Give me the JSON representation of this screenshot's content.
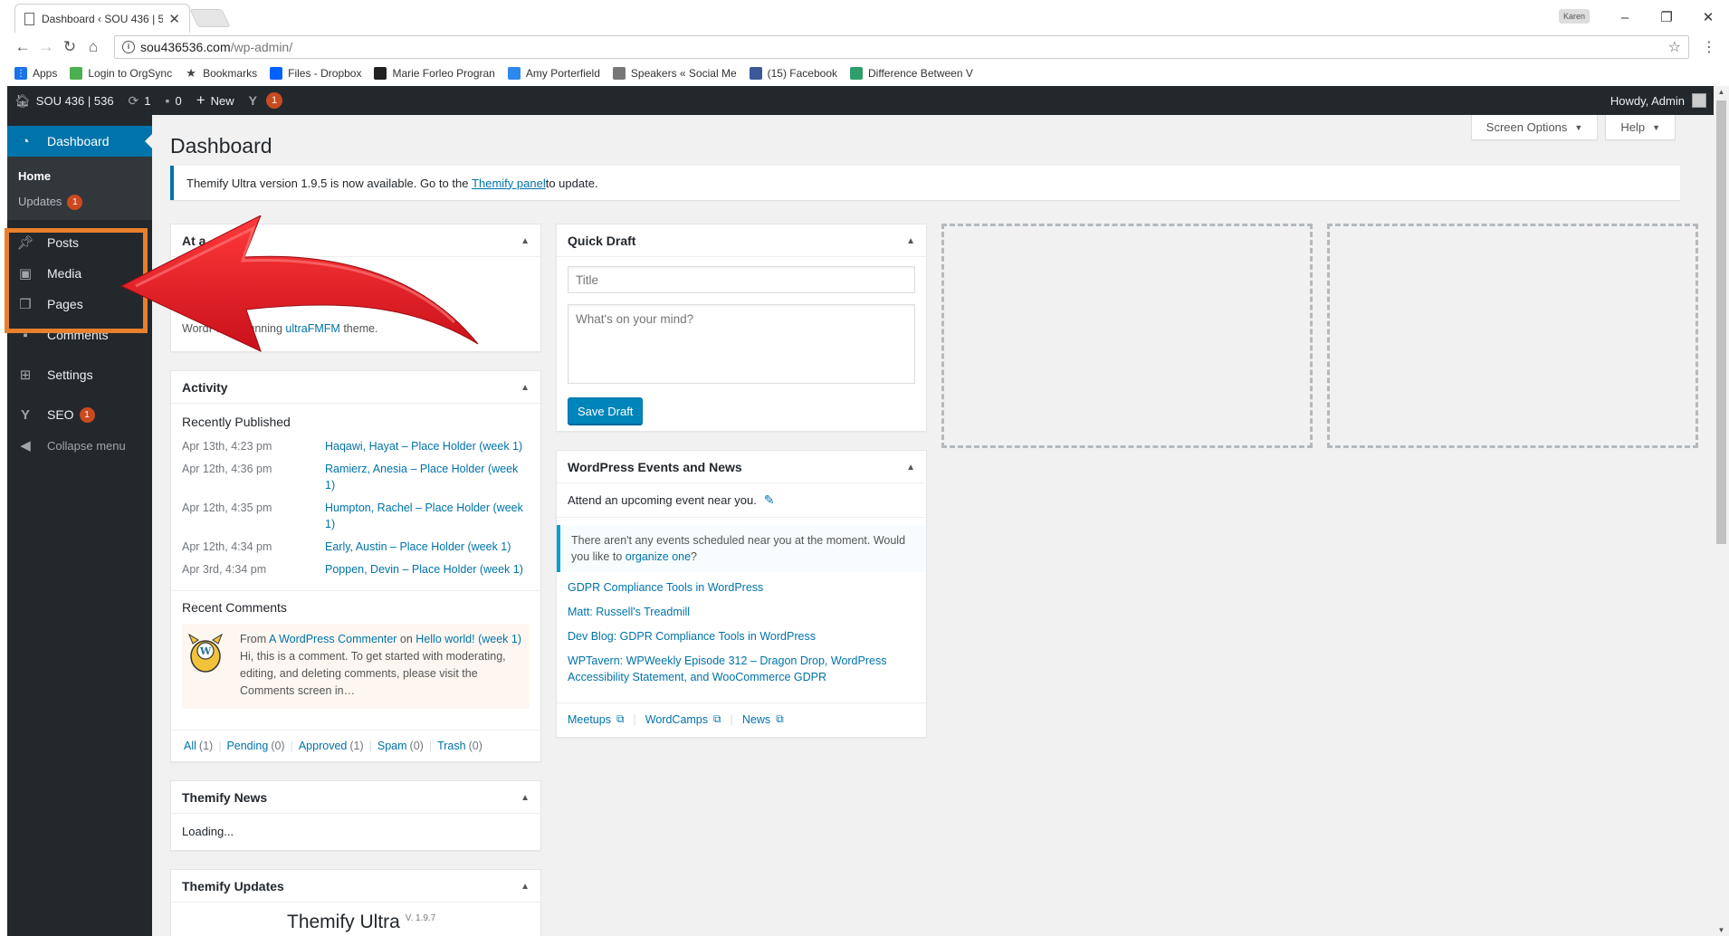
{
  "browser": {
    "tab_title": "Dashboard ‹ SOU 436 | 5",
    "profile_label": "Karen",
    "url_host": "sou436536.com",
    "url_path": "/wp-admin/",
    "bookmarks": [
      {
        "label": "Apps",
        "icon": "apps-grid-icon",
        "color": "#1a73e8"
      },
      {
        "label": "Login to OrgSync",
        "icon": "orgsync-icon",
        "color": "#4caf50"
      },
      {
        "label": "Bookmarks",
        "icon": "star-icon",
        "color": "#444444"
      },
      {
        "label": "Files - Dropbox",
        "icon": "dropbox-icon",
        "color": "#0061ff"
      },
      {
        "label": "Marie Forleo Progran",
        "icon": "mf-icon",
        "color": "#222222"
      },
      {
        "label": "Amy Porterfield",
        "icon": "amy-icon",
        "color": "#2d89ef"
      },
      {
        "label": "Speakers « Social Me",
        "icon": "doc-icon",
        "color": "#777777"
      },
      {
        "label": "(15) Facebook",
        "icon": "facebook-icon",
        "color": "#3b5998"
      },
      {
        "label": "Difference Between V",
        "icon": "c-icon",
        "color": "#2e9e6b"
      }
    ]
  },
  "adminbar": {
    "site_name": "SOU 436 | 536",
    "updates_count": "1",
    "comments_count": "0",
    "new_label": "New",
    "yoast_count": "1",
    "howdy": "Howdy, Admin"
  },
  "sidebar": {
    "dashboard": "Dashboard",
    "home": "Home",
    "updates": "Updates",
    "updates_count": "1",
    "posts": "Posts",
    "media": "Media",
    "pages": "Pages",
    "comments": "Comments",
    "settings": "Settings",
    "seo": "SEO",
    "seo_count": "1",
    "collapse": "Collapse menu"
  },
  "header": {
    "screen_options": "Screen Options",
    "help": "Help",
    "title": "Dashboard"
  },
  "notice": {
    "before": "Themify Ultra version 1.9.5 is now available. Go to the ",
    "link": "Themify panel",
    "after": " to update."
  },
  "at_a_glance": {
    "title": "At a",
    "theme_line_start": "WordPr",
    "theme_line_mid": "s running ",
    "theme_link": "ultraFMFM",
    "theme_line_end": " theme."
  },
  "activity": {
    "title": "Activity",
    "recently_published": "Recently Published",
    "posts": [
      {
        "date": "Apr 13th, 4:23 pm",
        "title": "Haqawi, Hayat – Place Holder (week 1)"
      },
      {
        "date": "Apr 12th, 4:36 pm",
        "title": "Ramierz, Anesia – Place Holder (week 1)"
      },
      {
        "date": "Apr 12th, 4:35 pm",
        "title": "Humpton, Rachel – Place Holder (week 1)"
      },
      {
        "date": "Apr 12th, 4:34 pm",
        "title": "Early, Austin – Place Holder (week 1)"
      },
      {
        "date": "Apr 3rd, 4:34 pm",
        "title": "Poppen, Devin – Place Holder (week 1)"
      }
    ],
    "recent_comments": "Recent Comments",
    "comment": {
      "from": "From ",
      "author": "A WordPress Commenter",
      "on": " on ",
      "post": "Hello world! (week 1)",
      "text": "Hi, this is a comment. To get started with moderating, editing, and deleting comments, please visit the Comments screen in…"
    },
    "filters": [
      {
        "label": "All",
        "count": "(1)"
      },
      {
        "label": "Pending",
        "count": "(0)"
      },
      {
        "label": "Approved",
        "count": "(1)"
      },
      {
        "label": "Spam",
        "count": "(0)"
      },
      {
        "label": "Trash",
        "count": "(0)"
      }
    ]
  },
  "themify_news": {
    "title": "Themify News",
    "loading": "Loading..."
  },
  "themify_updates": {
    "title": "Themify Updates",
    "product": "Themify Ultra",
    "version": "V. 1.9.7"
  },
  "quick_draft": {
    "title": "Quick Draft",
    "title_placeholder": "Title",
    "content_placeholder": "What's on your mind?",
    "save": "Save Draft"
  },
  "events": {
    "title": "WordPress Events and News",
    "attend": "Attend an upcoming event near you.",
    "none_text": "There aren't any events scheduled near you at the moment. Would you like to ",
    "none_link": "organize one",
    "none_end": "?",
    "news": [
      "GDPR Compliance Tools in WordPress",
      "Matt: Russell's Treadmill",
      "Dev Blog: GDPR Compliance Tools in WordPress",
      "WPTavern: WPWeekly Episode 312 – Dragon Drop, WordPress Accessibility Statement, and WooCommerce GDPR"
    ],
    "meetups": "Meetups",
    "wordcamps": "WordCamps",
    "news_link": "News"
  },
  "colors": {
    "admin_dark": "#23282d",
    "wp_blue": "#0073aa",
    "highlight_orange": "#e87f2d",
    "arrow_red": "#e8202a",
    "badge_orange": "#ca4a1f"
  }
}
